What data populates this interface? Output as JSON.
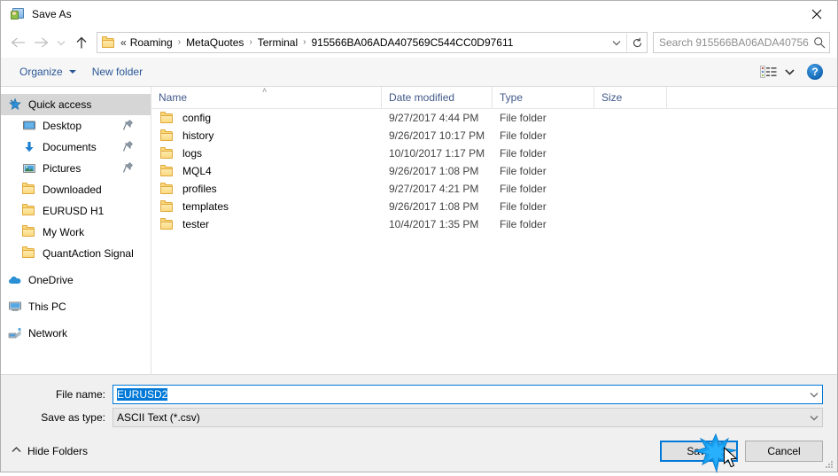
{
  "window": {
    "title": "Save As",
    "icon": "save-as-icon",
    "close_label": "✕"
  },
  "nav": {
    "back": "back-arrow",
    "forward": "forward-arrow",
    "recent": "recent-locations-chevron",
    "up": "up-arrow",
    "breadcrumb": {
      "leading": "«",
      "items": [
        "Roaming",
        "MetaQuotes",
        "Terminal",
        "915566BA06ADA407569C544CC0D97611"
      ],
      "separator": "›"
    },
    "address_dropdown": "chevron-down-icon",
    "refresh": "refresh-icon"
  },
  "search": {
    "placeholder": "Search 915566BA06ADA40756...",
    "icon": "search-icon"
  },
  "toolbar": {
    "organize_label": "Organize",
    "new_folder_label": "New folder",
    "view_icon": "view-options-icon",
    "view_caret": "chevron-down-icon",
    "help_label": "?"
  },
  "sidebar": {
    "items": [
      {
        "label": "Quick access",
        "icon": "quick-access-star-icon",
        "selected": true,
        "indent": false,
        "pinned": false,
        "group": false
      },
      {
        "label": "Desktop",
        "icon": "desktop-icon",
        "selected": false,
        "indent": true,
        "pinned": true,
        "group": false
      },
      {
        "label": "Documents",
        "icon": "documents-download-icon",
        "selected": false,
        "indent": true,
        "pinned": true,
        "group": false
      },
      {
        "label": "Pictures",
        "icon": "pictures-icon",
        "selected": false,
        "indent": true,
        "pinned": true,
        "group": false
      },
      {
        "label": "Downloaded",
        "icon": "folder-icon",
        "selected": false,
        "indent": true,
        "pinned": false,
        "group": false
      },
      {
        "label": "EURUSD H1",
        "icon": "folder-icon",
        "selected": false,
        "indent": true,
        "pinned": false,
        "group": false
      },
      {
        "label": "My Work",
        "icon": "folder-icon",
        "selected": false,
        "indent": true,
        "pinned": false,
        "group": false
      },
      {
        "label": "QuantAction Signal",
        "icon": "folder-icon",
        "selected": false,
        "indent": true,
        "pinned": false,
        "group": false
      },
      {
        "label": "OneDrive",
        "icon": "onedrive-cloud-icon",
        "selected": false,
        "indent": false,
        "pinned": false,
        "group": true
      },
      {
        "label": "This PC",
        "icon": "this-pc-monitor-icon",
        "selected": false,
        "indent": false,
        "pinned": false,
        "group": true
      },
      {
        "label": "Network",
        "icon": "network-icon",
        "selected": false,
        "indent": false,
        "pinned": false,
        "group": true
      }
    ]
  },
  "filelist": {
    "columns": [
      "Name",
      "Date modified",
      "Type",
      "Size"
    ],
    "sort_indicator": "˄",
    "rows": [
      {
        "name": "config",
        "date": "9/27/2017 4:44 PM",
        "type": "File folder",
        "size": ""
      },
      {
        "name": "history",
        "date": "9/26/2017 10:17 PM",
        "type": "File folder",
        "size": ""
      },
      {
        "name": "logs",
        "date": "10/10/2017 1:17 PM",
        "type": "File folder",
        "size": ""
      },
      {
        "name": "MQL4",
        "date": "9/26/2017 1:08 PM",
        "type": "File folder",
        "size": ""
      },
      {
        "name": "profiles",
        "date": "9/27/2017 4:21 PM",
        "type": "File folder",
        "size": ""
      },
      {
        "name": "templates",
        "date": "9/26/2017 1:08 PM",
        "type": "File folder",
        "size": ""
      },
      {
        "name": "tester",
        "date": "10/4/2017 1:35 PM",
        "type": "File folder",
        "size": ""
      }
    ]
  },
  "form": {
    "filename_label": "File name:",
    "filename_value": "EURUSD2",
    "filename_selected": true,
    "savetype_label": "Save as type:",
    "savetype_value": "ASCII Text (*.csv)",
    "dropdown_icon": "chevron-down-icon"
  },
  "footer": {
    "hide_folders_label": "Hide Folders",
    "hide_folders_chevron": "˄",
    "save_label": "Save",
    "cancel_label": "Cancel"
  },
  "colors": {
    "accent": "#0078d7",
    "breadcrumb_bg": "#ffffff",
    "dialog_bg": "#f0f0f0",
    "header_text": "#41598a",
    "link": "#2b5797",
    "folder_yellow": "#fbd97a",
    "selection": "#d6d6d6"
  }
}
